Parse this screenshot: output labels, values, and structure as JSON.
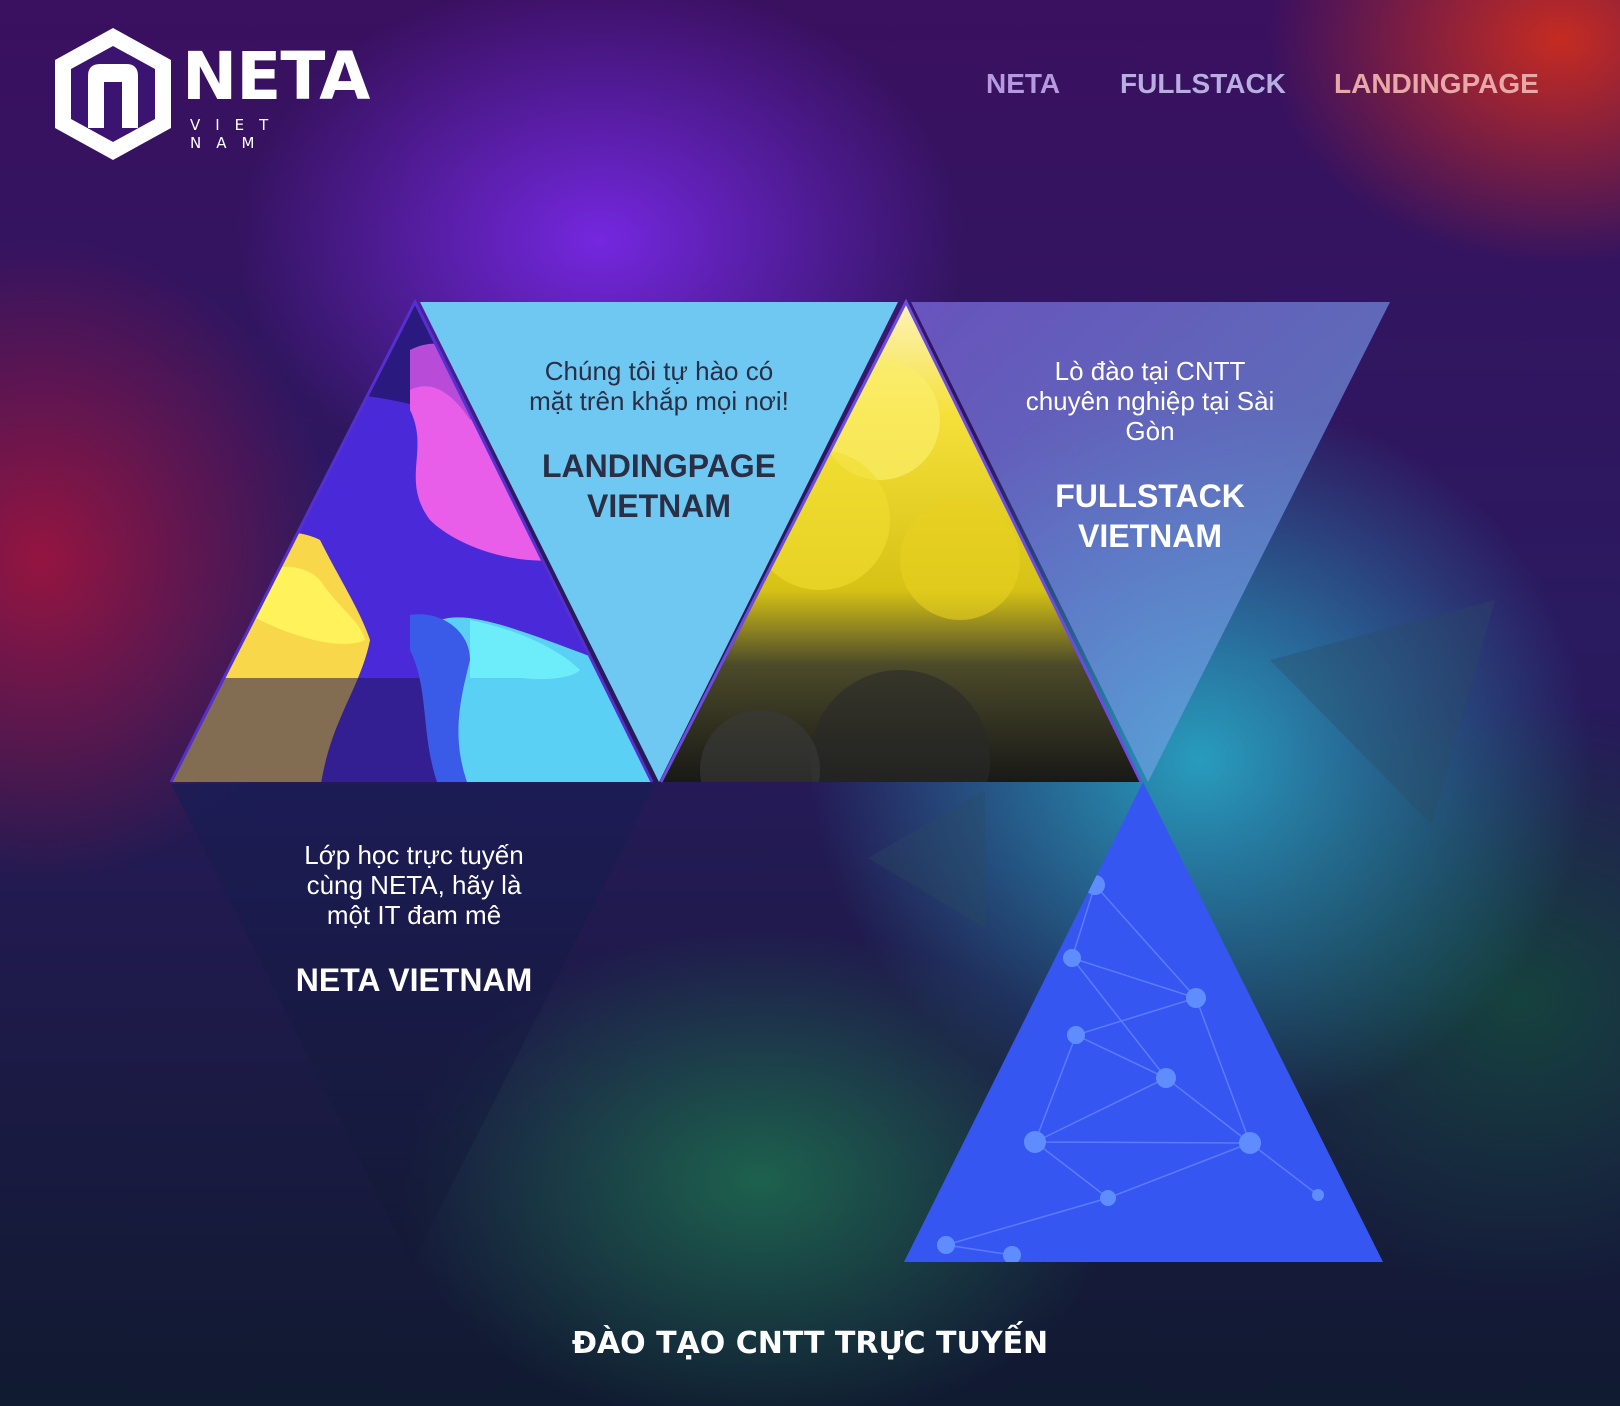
{
  "header": {
    "logo_word": "NETA",
    "logo_sub": "VIET NAM"
  },
  "nav": {
    "items": [
      {
        "label": "NETA"
      },
      {
        "label": "FULLSTACK"
      },
      {
        "label": "LANDINGPAGE"
      }
    ]
  },
  "cards": {
    "landingpage": {
      "desc": "Chúng tôi tự hào có mặt trên khắp mọi nơi!",
      "title": "LANDINGPAGE VIETNAM"
    },
    "fullstack": {
      "desc": "Lò đào tại CNTT chuyên nghiệp tại Sài Gòn",
      "title": "FULLSTACK VIETNAM"
    },
    "neta": {
      "desc": "Lớp học trực tuyến cùng NETA, hãy là một IT đam mê",
      "title": "NETA VIETNAM"
    }
  },
  "footer": {
    "title": "ĐÀO TẠO CNTT TRỰC TUYẾN"
  },
  "colors": {
    "nav_neta": "#b59ae0",
    "nav_fullstack": "#b8aee0",
    "nav_landingpage": "#e8a8a8",
    "card_light_blue": "#6ec8f2",
    "card_blue": "#3a5cf4",
    "text_dark": "#2a2f45"
  }
}
